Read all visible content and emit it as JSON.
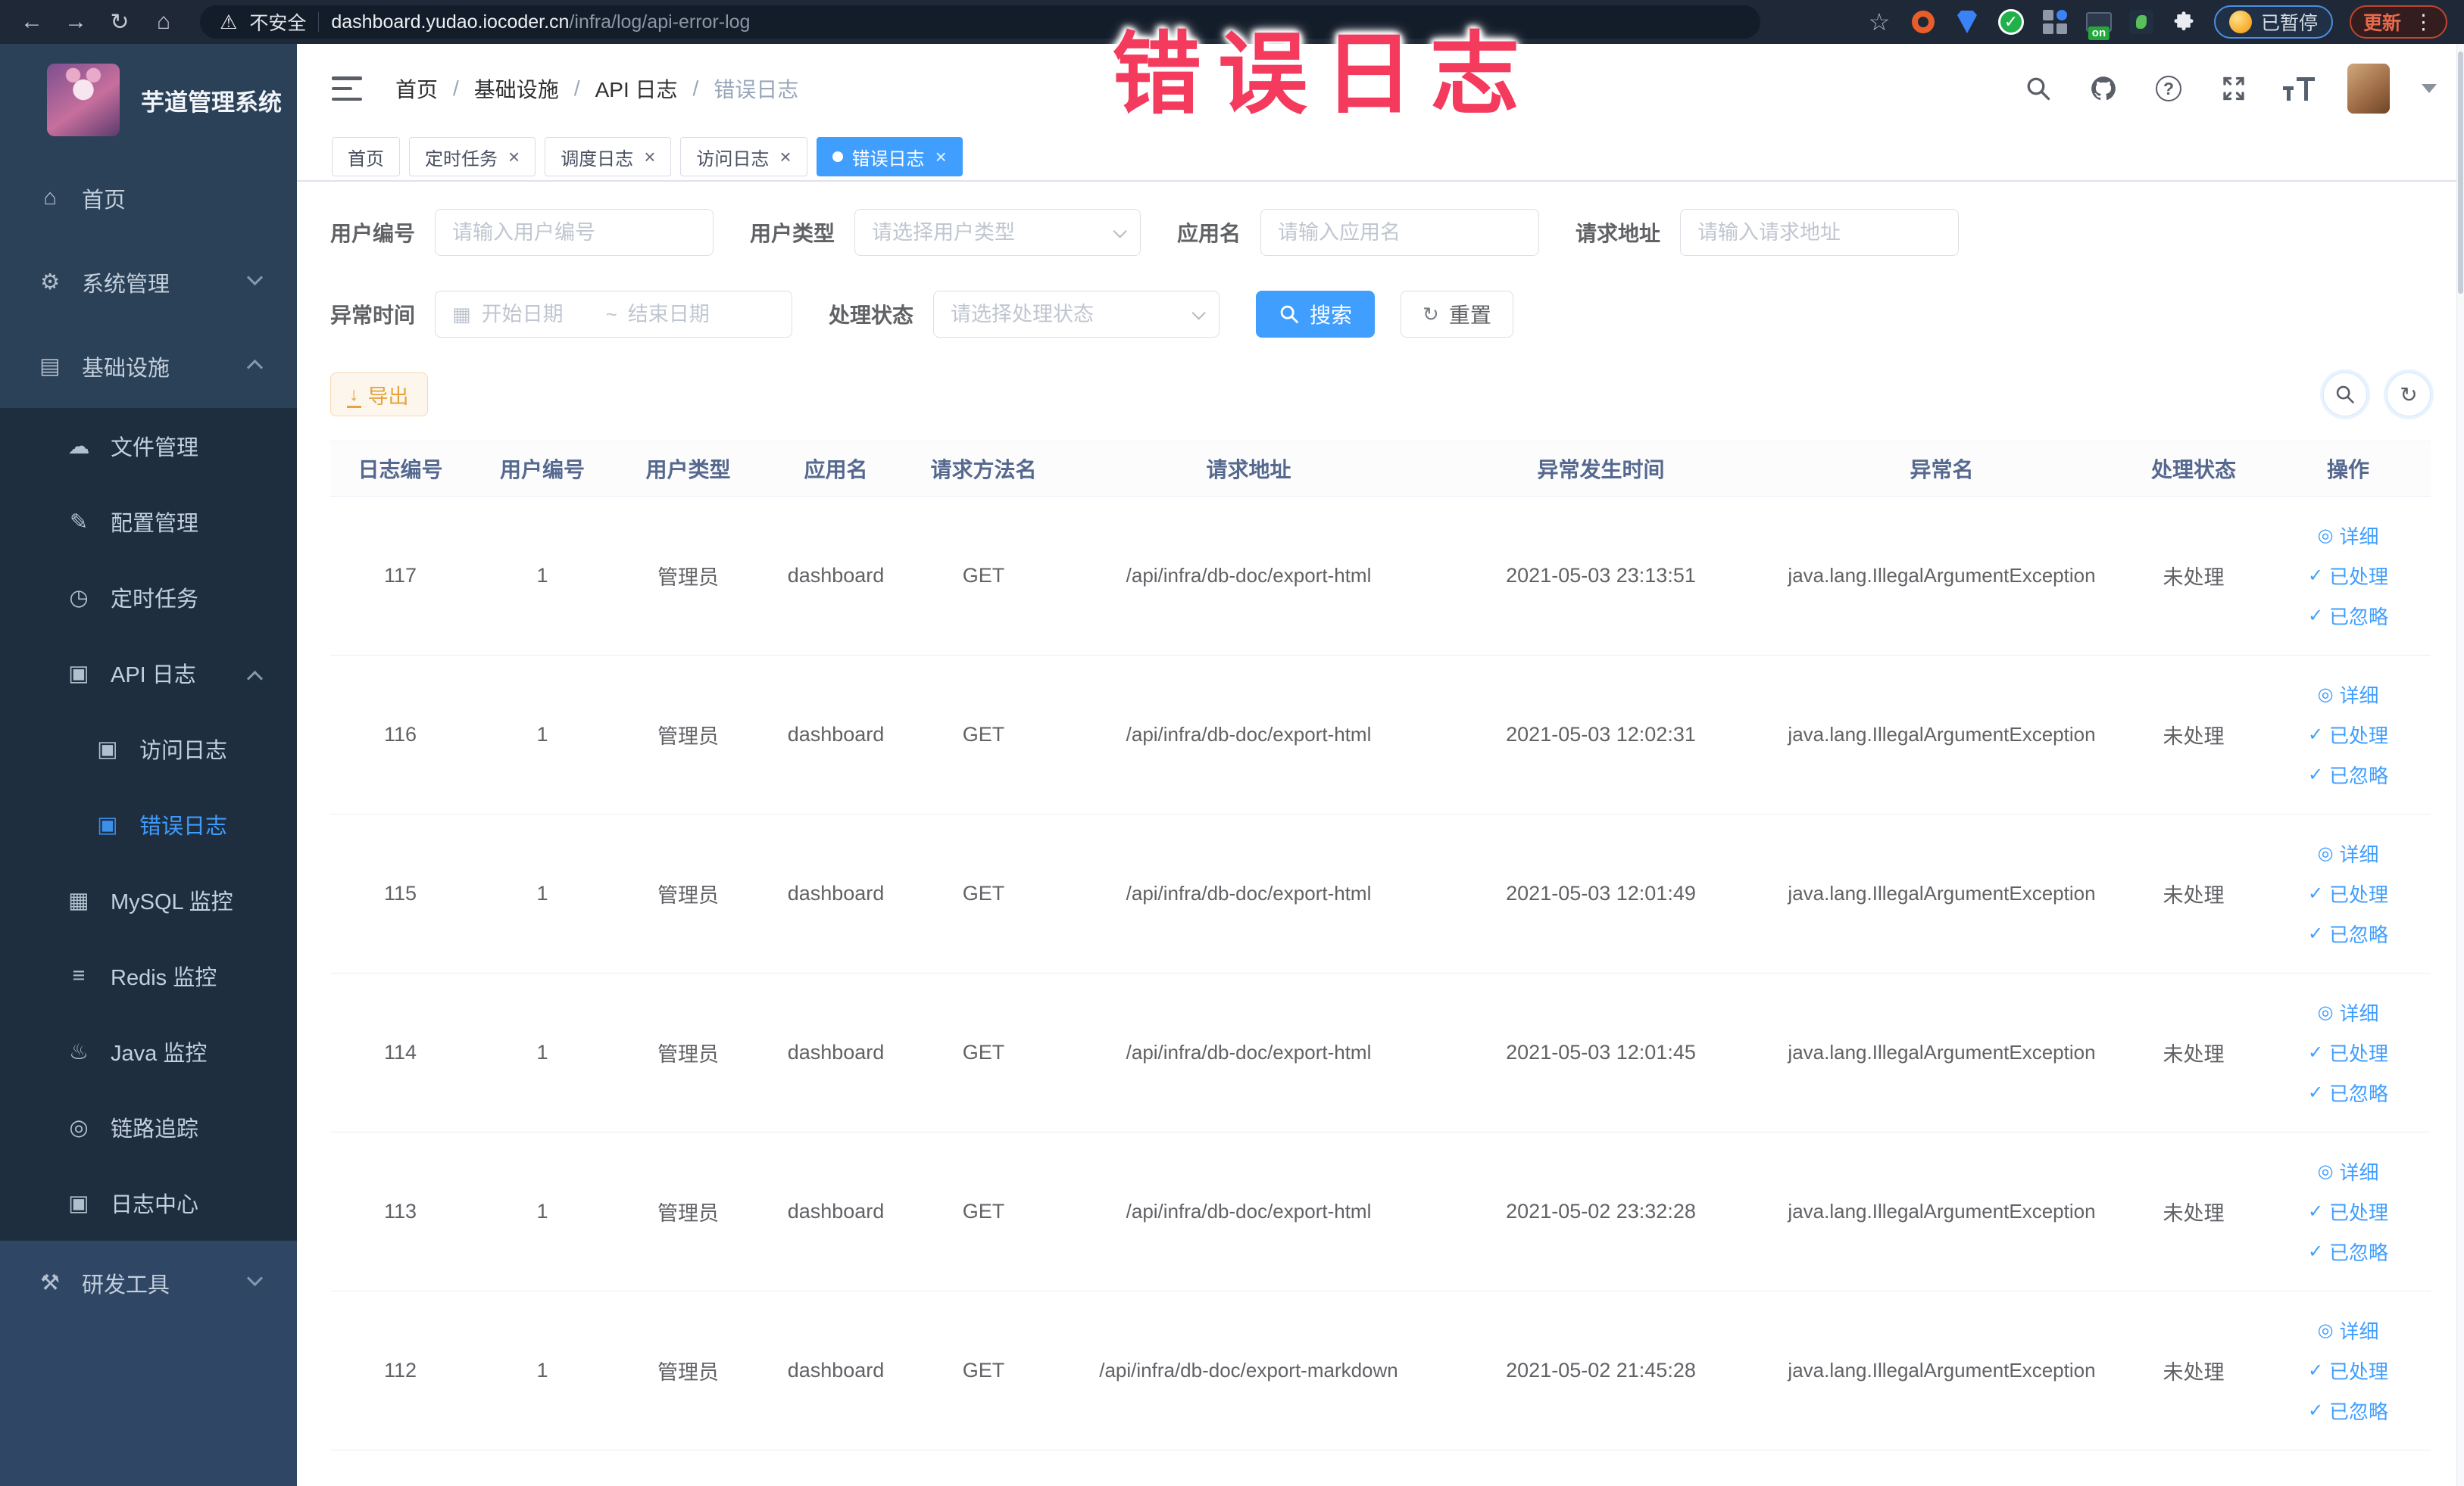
{
  "browser": {
    "security_label": "不安全",
    "url_host": "dashboard.yudao.iocoder.cn",
    "url_path": "/infra/log/api-error-log",
    "ext_on_badge": "on",
    "paused_label": "已暂停",
    "update_label": "更新"
  },
  "annotation": {
    "text": "错误日志"
  },
  "icons": {
    "back": "←",
    "forward": "→",
    "reload": "↻",
    "home": "⌂",
    "warning": "⚠",
    "star": "☆",
    "kebab": "⋮",
    "check": "✓",
    "eye": "◎",
    "refresh": "↻",
    "calendar": "▦",
    "download": "↓",
    "question": "?",
    "menu-home": "⌂",
    "menu-gear": "⚙",
    "menu-infra": "▤",
    "menu-file": "☁",
    "menu-config": "✎",
    "menu-job": "◷",
    "menu-log": "▣",
    "menu-mysql": "▦",
    "menu-redis": "≡",
    "menu-java": "♨",
    "menu-trace": "◎",
    "menu-tools": "⚒"
  },
  "sidebar": {
    "title": "芋道管理系统",
    "items": [
      {
        "id": "home",
        "label": "首页",
        "type": "root",
        "icon": "menu-home"
      },
      {
        "id": "system-mgmt",
        "label": "系统管理",
        "type": "root",
        "icon": "menu-gear",
        "chevron": "down"
      },
      {
        "id": "infra",
        "label": "基础设施",
        "type": "root",
        "icon": "menu-infra",
        "chevron": "up"
      },
      {
        "id": "file-mgmt",
        "label": "文件管理",
        "type": "sub",
        "icon": "menu-file"
      },
      {
        "id": "config-mgmt",
        "label": "配置管理",
        "type": "sub",
        "icon": "menu-config"
      },
      {
        "id": "cron-job",
        "label": "定时任务",
        "type": "sub",
        "icon": "menu-job"
      },
      {
        "id": "api-log",
        "label": "API 日志",
        "type": "sub",
        "icon": "menu-log",
        "chevron": "up"
      },
      {
        "id": "access-log",
        "label": "访问日志",
        "type": "sub2",
        "icon": "menu-log"
      },
      {
        "id": "error-log",
        "label": "错误日志",
        "type": "sub2",
        "icon": "menu-log",
        "active": true
      },
      {
        "id": "mysql-monitor",
        "label": "MySQL 监控",
        "type": "sub",
        "icon": "menu-mysql"
      },
      {
        "id": "redis-monitor",
        "label": "Redis 监控",
        "type": "sub",
        "icon": "menu-redis"
      },
      {
        "id": "java-monitor",
        "label": "Java 监控",
        "type": "sub",
        "icon": "menu-java"
      },
      {
        "id": "trace",
        "label": "链路追踪",
        "type": "sub",
        "icon": "menu-trace"
      },
      {
        "id": "log-center",
        "label": "日志中心",
        "type": "sub",
        "icon": "menu-log"
      },
      {
        "id": "dev-tools",
        "label": "研发工具",
        "type": "root-light",
        "icon": "menu-tools",
        "chevron": "down"
      }
    ]
  },
  "header": {
    "breadcrumb": [
      "首页",
      "基础设施",
      "API 日志",
      "错误日志"
    ]
  },
  "tabs": [
    {
      "id": "home",
      "label": "首页",
      "closable": false,
      "active": false
    },
    {
      "id": "cron-job",
      "label": "定时任务",
      "closable": true,
      "active": false
    },
    {
      "id": "schedule-log",
      "label": "调度日志",
      "closable": true,
      "active": false
    },
    {
      "id": "access-log",
      "label": "访问日志",
      "closable": true,
      "active": false
    },
    {
      "id": "error-log",
      "label": "错误日志",
      "closable": true,
      "active": true
    }
  ],
  "filters": {
    "user_id": {
      "label": "用户编号",
      "placeholder": "请输入用户编号"
    },
    "user_type": {
      "label": "用户类型",
      "placeholder": "请选择用户类型"
    },
    "app_name": {
      "label": "应用名",
      "placeholder": "请输入应用名"
    },
    "request_url": {
      "label": "请求地址",
      "placeholder": "请输入请求地址"
    },
    "exception_time": {
      "label": "异常时间",
      "start_placeholder": "开始日期",
      "separator": "~",
      "end_placeholder": "结束日期"
    },
    "process_status": {
      "label": "处理状态",
      "placeholder": "请选择处理状态"
    },
    "search_label": "搜索",
    "reset_label": "重置"
  },
  "toolbar": {
    "export_label": "导出"
  },
  "table": {
    "columns": [
      "日志编号",
      "用户编号",
      "用户类型",
      "应用名",
      "请求方法名",
      "请求地址",
      "异常发生时间",
      "异常名",
      "处理状态",
      "操作"
    ],
    "row_actions": [
      {
        "label": "详细",
        "icon": "eye"
      },
      {
        "label": "已处理",
        "icon": "check"
      },
      {
        "label": "已忽略",
        "icon": "check"
      }
    ],
    "rows": [
      {
        "id": "117",
        "user_id": "1",
        "user_type": "管理员",
        "app": "dashboard",
        "method": "GET",
        "url": "/api/infra/db-doc/export-html",
        "time": "2021-05-03 23:13:51",
        "exception": "java.lang.IllegalArgumentException",
        "status": "未处理"
      },
      {
        "id": "116",
        "user_id": "1",
        "user_type": "管理员",
        "app": "dashboard",
        "method": "GET",
        "url": "/api/infra/db-doc/export-html",
        "time": "2021-05-03 12:02:31",
        "exception": "java.lang.IllegalArgumentException",
        "status": "未处理"
      },
      {
        "id": "115",
        "user_id": "1",
        "user_type": "管理员",
        "app": "dashboard",
        "method": "GET",
        "url": "/api/infra/db-doc/export-html",
        "time": "2021-05-03 12:01:49",
        "exception": "java.lang.IllegalArgumentException",
        "status": "未处理"
      },
      {
        "id": "114",
        "user_id": "1",
        "user_type": "管理员",
        "app": "dashboard",
        "method": "GET",
        "url": "/api/infra/db-doc/export-html",
        "time": "2021-05-03 12:01:45",
        "exception": "java.lang.IllegalArgumentException",
        "status": "未处理"
      },
      {
        "id": "113",
        "user_id": "1",
        "user_type": "管理员",
        "app": "dashboard",
        "method": "GET",
        "url": "/api/infra/db-doc/export-html",
        "time": "2021-05-02 23:32:28",
        "exception": "java.lang.IllegalArgumentException",
        "status": "未处理"
      },
      {
        "id": "112",
        "user_id": "1",
        "user_type": "管理员",
        "app": "dashboard",
        "method": "GET",
        "url": "/api/infra/db-doc/export-markdown",
        "time": "2021-05-02 21:45:28",
        "exception": "java.lang.IllegalArgumentException",
        "status": "未处理"
      }
    ]
  }
}
